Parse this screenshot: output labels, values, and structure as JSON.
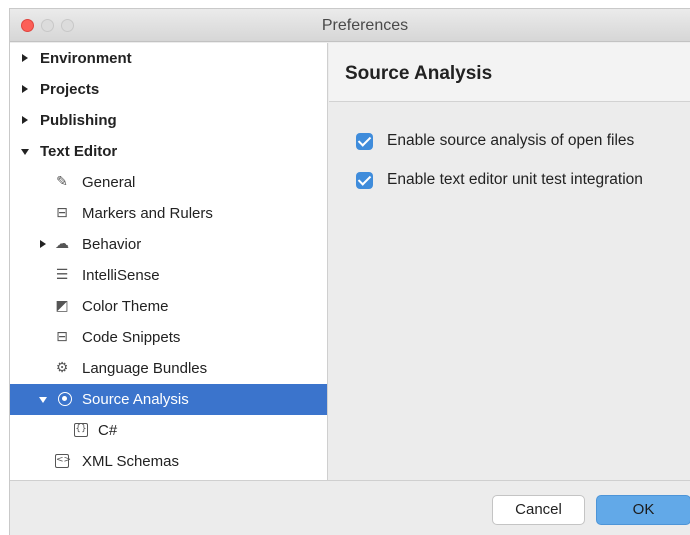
{
  "window": {
    "title": "Preferences"
  },
  "sidebar": {
    "items": [
      {
        "label": "Environment",
        "icon": ""
      },
      {
        "label": "Projects",
        "icon": ""
      },
      {
        "label": "Publishing",
        "icon": ""
      },
      {
        "label": "Text Editor",
        "icon": ""
      },
      {
        "label": "General",
        "icon": "pencil-square-icon"
      },
      {
        "label": "Markers and Rulers",
        "icon": "ruler-grid-icon"
      },
      {
        "label": "Behavior",
        "icon": "behavior-icon"
      },
      {
        "label": "IntelliSense",
        "icon": "list-icon"
      },
      {
        "label": "Color Theme",
        "icon": "color-theme-icon"
      },
      {
        "label": "Code Snippets",
        "icon": "snippet-icon"
      },
      {
        "label": "Language Bundles",
        "icon": "gear-icon"
      },
      {
        "label": "Source Analysis",
        "icon": "radio-icon"
      },
      {
        "label": "C#",
        "icon": "braces-icon"
      },
      {
        "label": "XML Schemas",
        "icon": "xml-icon"
      }
    ]
  },
  "content": {
    "title": "Source Analysis",
    "options": [
      {
        "label": "Enable source analysis of open files",
        "checked": true
      },
      {
        "label": "Enable text editor unit test integration",
        "checked": true
      }
    ]
  },
  "footer": {
    "cancel_label": "Cancel",
    "ok_label": "OK"
  },
  "colors": {
    "selection": "#3b74cc",
    "checkbox": "#3f8cdb",
    "ok_button": "#62a9e8",
    "close_button": "#fc5f57"
  }
}
